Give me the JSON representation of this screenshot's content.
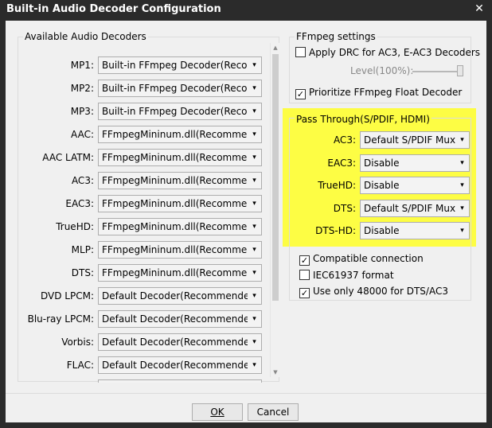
{
  "window": {
    "title": "Built-in Audio Decoder Configuration",
    "close_glyph": "✕"
  },
  "decoders": {
    "title": "Available Audio Decoders",
    "rows": [
      {
        "label": "MP1:",
        "value": "Built-in FFmpeg Decoder(Recommended)"
      },
      {
        "label": "MP2:",
        "value": "Built-in FFmpeg Decoder(Recommended)"
      },
      {
        "label": "MP3:",
        "value": "Built-in FFmpeg Decoder(Recommended)"
      },
      {
        "label": "AAC:",
        "value": "FFmpegMininum.dll(Recommended)"
      },
      {
        "label": "AAC LATM:",
        "value": "FFmpegMininum.dll(Recommended)"
      },
      {
        "label": "AC3:",
        "value": "FFmpegMininum.dll(Recommended)"
      },
      {
        "label": "EAC3:",
        "value": "FFmpegMininum.dll(Recommended)"
      },
      {
        "label": "TrueHD:",
        "value": "FFmpegMininum.dll(Recommended)"
      },
      {
        "label": "MLP:",
        "value": "FFmpegMininum.dll(Recommended)"
      },
      {
        "label": "DTS:",
        "value": "FFmpegMininum.dll(Recommended)"
      },
      {
        "label": "DVD LPCM:",
        "value": "Default Decoder(Recommended)"
      },
      {
        "label": "Blu-ray LPCM:",
        "value": "Default Decoder(Recommended)"
      },
      {
        "label": "Vorbis:",
        "value": "Default Decoder(Recommended)"
      },
      {
        "label": "FLAC:",
        "value": "Default Decoder(Recommended)"
      }
    ]
  },
  "ffmpeg": {
    "title": "FFmpeg settings",
    "drc_label": "Apply DRC for AC3, E-AC3 Decoders",
    "drc_checked": false,
    "level_label": "Level(100%):",
    "level_fraction": 1.0,
    "float_label": "Prioritize FFmpeg Float Decoder",
    "float_checked": true
  },
  "passthrough": {
    "title": "Pass Through(S/PDIF, HDMI)",
    "highlight_color": "#fdfd44",
    "rows": [
      {
        "label": "AC3:",
        "value": "Default S/PDIF Muxer"
      },
      {
        "label": "EAC3:",
        "value": "Disable"
      },
      {
        "label": "TrueHD:",
        "value": "Disable"
      },
      {
        "label": "DTS:",
        "value": "Default S/PDIF Muxer"
      },
      {
        "label": "DTS-HD:",
        "value": "Disable"
      }
    ],
    "compatible_label": "Compatible connection",
    "compatible_checked": true,
    "iec_label": "IEC61937 format",
    "iec_checked": false,
    "only48_label": "Use only 48000 for DTS/AC3",
    "only48_checked": true
  },
  "buttons": {
    "ok_label": "OK",
    "cancel_label": "Cancel"
  }
}
